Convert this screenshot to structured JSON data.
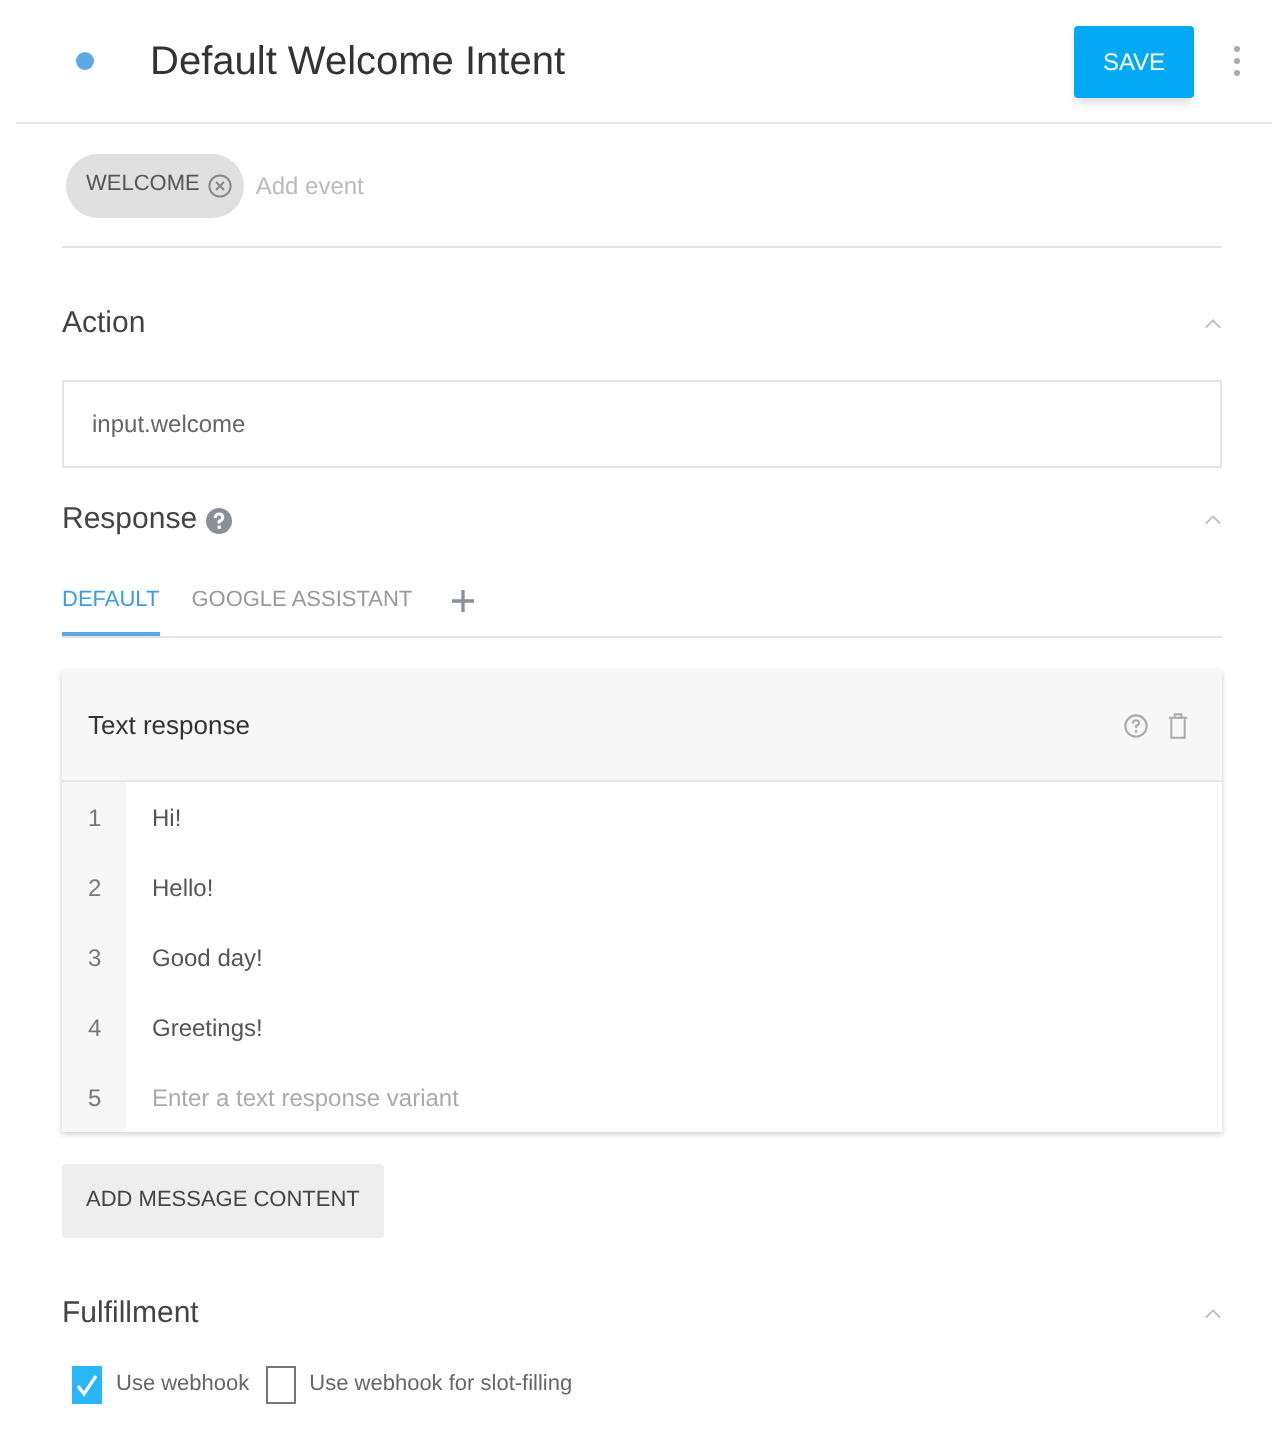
{
  "header": {
    "title": "Default Welcome Intent",
    "save": "SAVE"
  },
  "events": {
    "chips": [
      "WELCOME"
    ],
    "placeholder": "Add event"
  },
  "action": {
    "title": "Action",
    "expanded": true,
    "value": "input.welcome"
  },
  "response": {
    "title": "Response",
    "expanded": true,
    "tabs": [
      {
        "label": "DEFAULT",
        "selected": true
      },
      {
        "label": "GOOGLE ASSISTANT",
        "selected": false
      }
    ],
    "card": {
      "title": "Text response",
      "rows": [
        {
          "number": "1",
          "text": "Hi!"
        },
        {
          "number": "2",
          "text": "Hello!"
        },
        {
          "number": "3",
          "text": "Good day!"
        },
        {
          "number": "4",
          "text": "Greetings!"
        },
        {
          "number": "5",
          "placeholder": "Enter a text response variant"
        }
      ]
    },
    "add_button": "ADD MESSAGE CONTENT"
  },
  "fulfillment": {
    "title": "Fulfillment",
    "expanded": true,
    "options": [
      {
        "label": "Use webhook",
        "checked": true
      },
      {
        "label": "Use webhook for slot-filling",
        "checked": false
      }
    ]
  }
}
